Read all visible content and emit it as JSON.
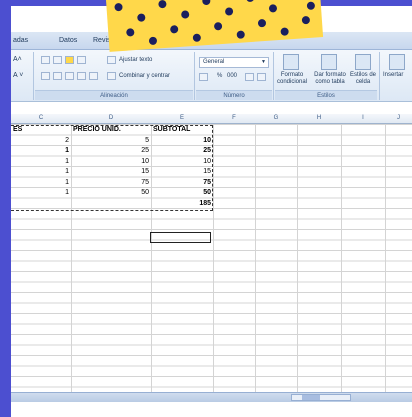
{
  "tabs": [
    "adas",
    "Datos",
    "Revisar"
  ],
  "ribbon": {
    "wrap_text": "Ajustar texto",
    "merge_center": "Combinar y centrar",
    "alignment_label": "Alineación",
    "number_format": "General",
    "number_label": "Número",
    "conditional_format": "Formato condicional",
    "format_table": "Dar formato como tabla",
    "cell_styles": "Estilos de celda",
    "styles_label": "Estilos",
    "insert": "Insertar",
    "percent": "%",
    "thousands": "000"
  },
  "columns": [
    "C",
    "D",
    "E",
    "F",
    "G",
    "H",
    "I",
    "J"
  ],
  "headers": {
    "c": "ES",
    "d": "PRECIO UNID.",
    "e": "SUBTOTAL"
  },
  "rows": [
    {
      "c": "2",
      "d": "5",
      "e": "10"
    },
    {
      "c": "1",
      "d": "25",
      "e": "25"
    },
    {
      "c": "1",
      "d": "10",
      "e": "10"
    },
    {
      "c": "1",
      "d": "15",
      "e": "15"
    },
    {
      "c": "1",
      "d": "75",
      "e": "75"
    },
    {
      "c": "1",
      "d": "50",
      "e": "50"
    }
  ],
  "total": "185",
  "colors": {
    "background": "#4c4fd0",
    "accent_yellow": "#ffd84a",
    "dots": "#1a1f5e"
  }
}
